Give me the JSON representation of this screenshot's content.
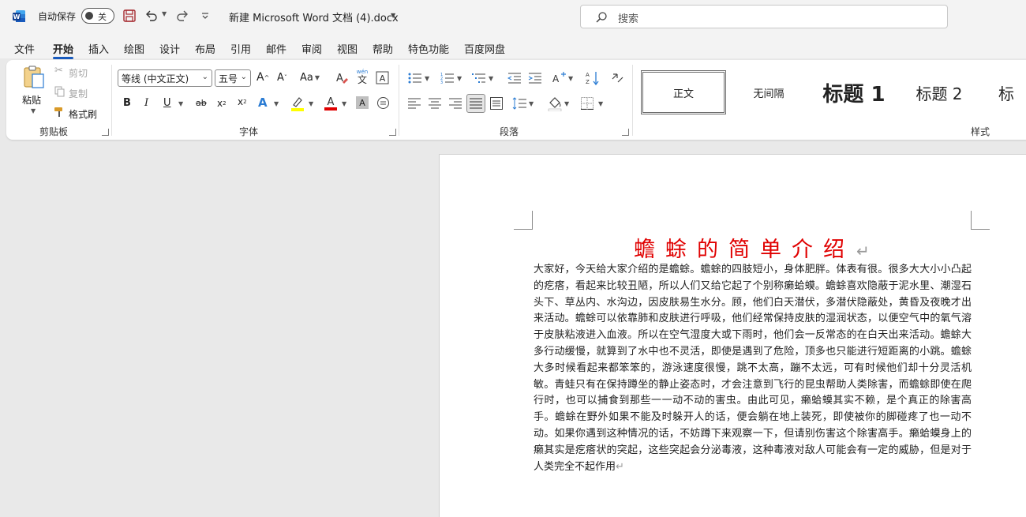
{
  "titlebar": {
    "autosave_label": "自动保存",
    "autosave_state": "关",
    "doc_title": "新建 Microsoft Word 文档 (4).docx",
    "search_placeholder": "搜索"
  },
  "tabs": [
    "文件",
    "开始",
    "插入",
    "绘图",
    "设计",
    "布局",
    "引用",
    "邮件",
    "审阅",
    "视图",
    "帮助",
    "特色功能",
    "百度网盘"
  ],
  "active_tab": "开始",
  "clipboard": {
    "paste": "粘贴",
    "cut": "剪切",
    "copy": "复制",
    "format_painter": "格式刷",
    "group": "剪贴板"
  },
  "font": {
    "family": "等线 (中文正文)",
    "size": "五号",
    "wen_label": "wén",
    "wen_char": "文",
    "bold": "B",
    "italic": "I",
    "underline": "U",
    "strike": "ab",
    "subscript": "x",
    "superscript": "x",
    "change_case": "Aa",
    "highlight_color": "#ffff00",
    "font_color": "#e00000",
    "group": "字体"
  },
  "paragraph": {
    "group": "段落"
  },
  "styles": {
    "items": [
      "正文",
      "无间隔",
      "标题 1",
      "标题 2",
      "标"
    ],
    "group": "样式"
  },
  "document": {
    "title": "蟾蜍的简单介绍",
    "return_mark": "↵",
    "body": "大家好，今天给大家介绍的是蟾蜍。蟾蜍的四肢短小，身体肥胖。体表有很。很多大大小小凸起的疙瘩，看起来比较丑陋，所以人们又给它起了个别称癞蛤蟆。蟾蜍喜欢隐蔽于泥水里、潮湿石头下、草丛内、水沟边，因皮肤易生水分。顾，他们白天潜伏，多潜伏隐蔽处，黄昏及夜晚才出来活动。蟾蜍可以依靠肺和皮肤进行呼吸，他们经常保持皮肤的湿润状态，以便空气中的氧气溶于皮肤粘液进入血液。所以在空气湿度大或下雨时，他们会一反常态的在白天出来活动。蟾蜍大多行动缓慢，就算到了水中也不灵活，即使是遇到了危险，顶多也只能进行短距离的小跳。蟾蜍大多时候看起来都笨笨的，游泳速度很慢，跳不太高，蹦不太远，可有时候他们却十分灵活机敏。青蛙只有在保持蹲坐的静止姿态时，才会注意到飞行的昆虫帮助人类除害，而蟾蜍即使在爬行时，也可以捕食到那些一一动不动的害虫。由此可见，癞蛤蟆其实不赖，是个真正的除害高手。蟾蜍在野外如果不能及时躲开人的话，便会躺在地上装死，即使被你的脚碰疼了也一动不动。如果你遇到这种情况的话，不妨蹲下来观察一下，但请别伤害这个除害高手。癞蛤蟆身上的癞其实是疙瘩状的突起，这些突起会分泌毒液，这种毒液对敌人可能会有一定的威胁，但是对于人类完全不起作用",
    "end_mark": "↵"
  }
}
